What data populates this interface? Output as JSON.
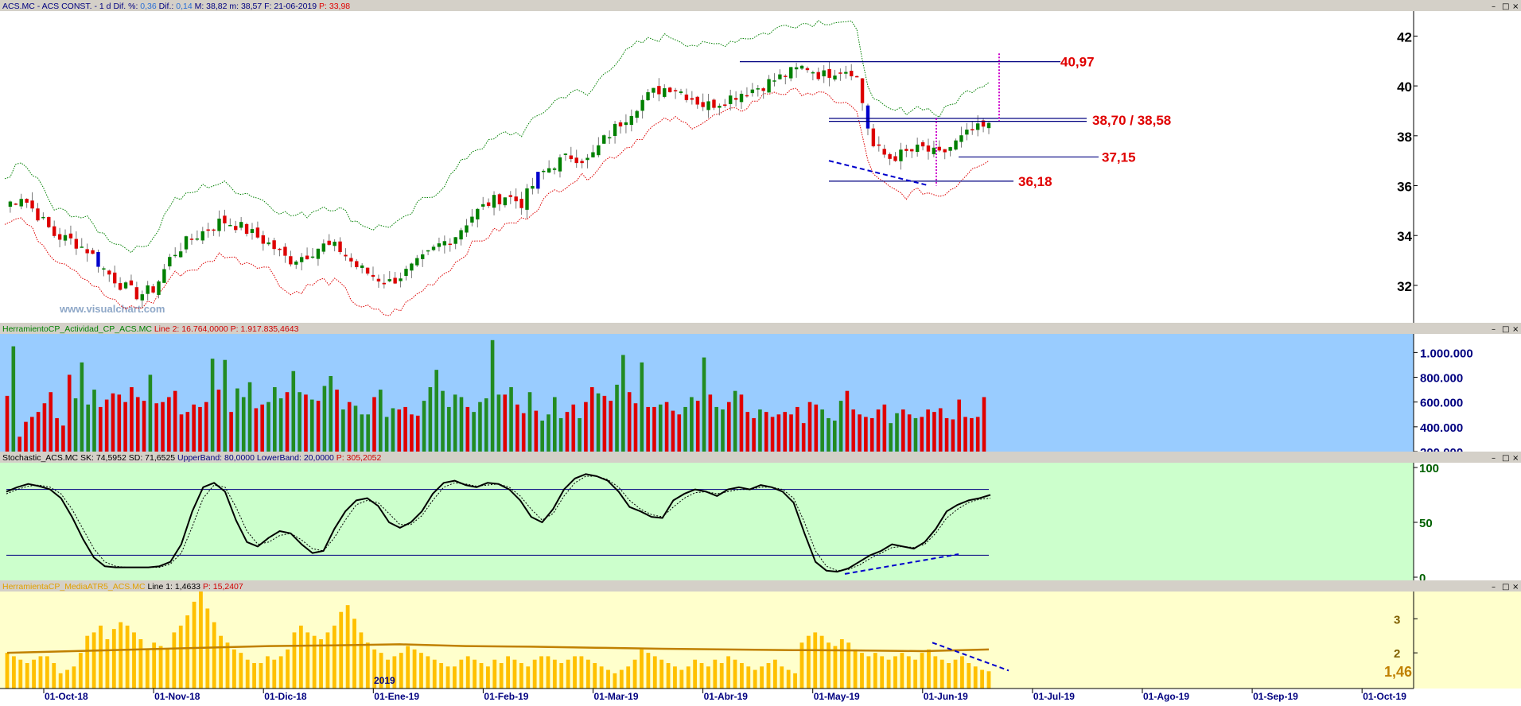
{
  "panels": {
    "price": {
      "title_parts": [
        {
          "text": "ACS.MC - ACS CONST. -  1 d  Dif. %: ",
          "color": "#000080"
        },
        {
          "text": "0,36",
          "color": "#2a6fd6"
        },
        {
          "text": "  Dif.: ",
          "color": "#000080"
        },
        {
          "text": "0,14",
          "color": "#2a6fd6"
        },
        {
          "text": "  M: 38,82  m: 38,57  F: 21-06-2019  ",
          "color": "#000080"
        },
        {
          "text": "P: 33,98",
          "color": "#e00000"
        }
      ],
      "y_ticks": [
        "32",
        "34",
        "36",
        "38",
        "40",
        "42"
      ],
      "watermark": "www.visualchart.com"
    },
    "volume": {
      "title_parts": [
        {
          "text": "HerramientoCP_Actividad_CP_ACS.MC ",
          "color": "#008000"
        },
        {
          "text": "Line 2: 16.764,0000  ",
          "color": "#d00000"
        },
        {
          "text": "P: 1.917.835,4643",
          "color": "#d00000"
        }
      ],
      "y_ticks": [
        "200.000",
        "400.000",
        "600.000",
        "800.000",
        "1.000.000"
      ]
    },
    "stochastic": {
      "title_parts": [
        {
          "text": "Stochastic_ACS.MC  SK: 74,5952  SD: 71,6525  ",
          "color": "#000000"
        },
        {
          "text": "UpperBand: 80,0000  ",
          "color": "#000080"
        },
        {
          "text": "LowerBand: 20,0000  ",
          "color": "#000080"
        },
        {
          "text": "P: 305,2052",
          "color": "#d00000"
        }
      ],
      "y_ticks": [
        "0",
        "50",
        "100"
      ]
    },
    "atr": {
      "title_parts": [
        {
          "text": "HerramientaCP_MediaATR5_ACS.MC ",
          "color": "#e0a000"
        },
        {
          "text": "Line 1: 1,4633  ",
          "color": "#000000"
        },
        {
          "text": "P: 15,2407",
          "color": "#d00000"
        }
      ],
      "y_ticks": [
        "2",
        "3"
      ],
      "last_value": "1,46",
      "year_label": "2019"
    }
  },
  "annotations": {
    "level_1": "40,97",
    "level_2": "38,70 / 38,58",
    "level_3": "37,15",
    "level_4": "36,18"
  },
  "x_axis_labels": [
    "01-Oct-18",
    "01-Nov-18",
    "01-Dic-18",
    "01-Ene-19",
    "01-Feb-19",
    "01-Mar-19",
    "01-Abr-19",
    "01-May-19",
    "01-Jun-19",
    "01-Jul-19",
    "01-Ago-19",
    "01-Sep-19",
    "01-Oct-19"
  ],
  "window_buttons": [
    "–",
    "□",
    "×"
  ],
  "colors": {
    "price_bg": "#ffffff",
    "volume_bg": "#99ccff",
    "stoch_bg": "#ccffcc",
    "atr_bg": "#ffffcc",
    "up_candle": "#008000",
    "down_candle": "#dd0000",
    "blue_candle": "#0000cc",
    "upper_band": "#008000",
    "lower_band": "#dd0000",
    "atr_bars": "#ffc000",
    "atr_avg": "#c08000",
    "level_text": "#e00000",
    "level_line": "#000080"
  },
  "chart_data": [
    {
      "type": "candlestick",
      "title": "ACS.MC - ACS CONST.",
      "period": "1 d",
      "x_start": "2018-09-21",
      "x_end": "2019-06-21",
      "ylim": [
        30.5,
        43
      ],
      "close_series": [
        35.2,
        35.6,
        34.8,
        34.0,
        33.8,
        33.4,
        32.6,
        32.0,
        31.6,
        31.9,
        33.2,
        33.8,
        34.2,
        34.6,
        34.4,
        34.0,
        33.6,
        33.0,
        33.2,
        33.6,
        33.5,
        32.8,
        32.4,
        32.1,
        32.5,
        33.0,
        33.6,
        34.0,
        34.8,
        35.3,
        35.6,
        35.3,
        36.4,
        36.9,
        37.2,
        37.0,
        37.9,
        38.6,
        39.3,
        39.8,
        40.0,
        39.6,
        39.2,
        39.4,
        39.7,
        39.9,
        40.2,
        40.5,
        40.8,
        40.4,
        40.7,
        40.6,
        37.6,
        37.1,
        37.3,
        37.5,
        37.2,
        37.7,
        38.2,
        38.35
      ],
      "upper_band": [
        36.3,
        36.9,
        36.2,
        35.0,
        34.9,
        34.6,
        34.0,
        33.6,
        33.4,
        34.0,
        35.4,
        35.6,
        36.0,
        36.1,
        35.8,
        35.6,
        35.2,
        34.8,
        34.8,
        35.2,
        35.1,
        34.6,
        34.3,
        34.4,
        34.6,
        35.4,
        35.8,
        36.6,
        37.4,
        37.7,
        38.1,
        38.1,
        38.8,
        39.4,
        39.8,
        39.6,
        40.6,
        41.2,
        41.7,
        41.9,
        42.0,
        41.7,
        41.6,
        41.7,
        41.9,
        42.0,
        42.2,
        42.5,
        42.5,
        42.6,
        42.6,
        42.4,
        39.4,
        39.0,
        39.0,
        39.2,
        38.8,
        39.4,
        39.9,
        40.2
      ],
      "lower_band": [
        34.6,
        34.7,
        33.9,
        33.1,
        32.8,
        32.2,
        31.6,
        31.1,
        31.1,
        31.4,
        32.4,
        32.6,
        32.8,
        33.3,
        33.0,
        32.9,
        32.6,
        31.6,
        31.9,
        32.2,
        32.1,
        31.3,
        31.0,
        30.8,
        31.2,
        31.8,
        32.3,
        32.9,
        33.6,
        34.0,
        34.4,
        34.6,
        35.2,
        35.8,
        36.2,
        36.4,
        37.0,
        37.4,
        37.9,
        38.4,
        38.7,
        38.4,
        38.6,
        38.9,
        39.0,
        39.4,
        39.8,
        39.7,
        39.8,
        39.6,
        39.4,
        39.1,
        36.4,
        35.9,
        35.6,
        35.8,
        35.6,
        36.0,
        36.8,
        37.0
      ],
      "levels": [
        40.97,
        38.7,
        38.58,
        37.15,
        36.18
      ]
    },
    {
      "type": "bar",
      "title": "HerramientoCP_Actividad_CP_ACS.MC",
      "ylim": [
        200000,
        1150000
      ],
      "values": [
        650,
        1050,
        320,
        440,
        480,
        520,
        590,
        680,
        470,
        410,
        820,
        630,
        920,
        580,
        700,
        560,
        620,
        670,
        660,
        600,
        720,
        640,
        610,
        820,
        590,
        600,
        640,
        690,
        500,
        520,
        580,
        560,
        600,
        950,
        700,
        940,
        520,
        710,
        640,
        760,
        550,
        580,
        600,
        720,
        630,
        680,
        850,
        680,
        660,
        620,
        610,
        730,
        810,
        700,
        540,
        600,
        570,
        500,
        500,
        640,
        700,
        480,
        550,
        540,
        560,
        500,
        490,
        610,
        720,
        860,
        690,
        560,
        660,
        640,
        560,
        520,
        600,
        630,
        1100,
        660,
        660,
        720,
        580,
        510,
        680,
        530,
        450,
        500,
        640,
        470,
        520,
        580,
        470,
        600,
        720,
        670,
        650,
        610,
        740,
        980,
        680,
        590,
        920,
        560,
        560,
        580,
        600,
        530,
        500,
        560,
        640,
        610,
        960,
        660,
        560,
        540,
        600,
        690,
        660,
        520,
        470,
        540,
        520,
        480,
        500,
        520,
        500,
        560,
        430,
        600,
        580,
        540,
        470,
        450,
        610,
        690,
        540,
        500,
        480,
        470,
        540,
        580,
        430,
        510,
        540,
        500,
        470,
        480,
        540,
        520,
        550,
        470,
        460,
        620,
        480,
        470,
        480,
        640
      ],
      "up_flags": [
        0,
        1,
        0,
        0,
        0,
        0,
        0,
        0,
        0,
        0,
        0,
        1,
        1,
        1,
        1,
        0,
        0,
        0,
        0,
        0,
        0,
        0,
        0,
        1,
        0,
        0,
        0,
        0,
        0,
        0,
        0,
        0,
        0,
        1,
        0,
        1,
        0,
        1,
        1,
        1,
        0,
        0,
        1,
        1,
        1,
        0,
        1,
        1,
        0,
        1,
        0,
        1,
        1,
        0,
        1,
        0,
        1,
        1,
        1,
        0,
        1,
        1,
        1,
        0,
        0,
        0,
        0,
        1,
        1,
        1,
        1,
        1,
        1,
        1,
        0,
        1,
        1,
        1,
        1,
        1,
        0,
        1,
        0,
        0,
        1,
        0,
        1,
        1,
        1,
        1,
        0,
        0,
        1,
        0,
        0,
        1,
        0,
        0,
        1,
        1,
        0,
        0,
        1,
        0,
        0,
        1,
        0,
        0,
        0,
        1,
        1,
        0,
        1,
        0,
        1,
        1,
        0,
        1,
        0,
        0,
        0,
        1,
        0,
        0,
        0,
        0,
        0,
        0,
        0,
        0,
        0,
        1,
        1,
        1,
        1,
        0,
        0,
        0,
        0,
        0,
        0,
        0,
        1,
        1,
        0,
        0,
        1,
        0,
        0,
        0,
        0,
        0,
        0,
        0,
        0,
        0,
        0,
        0,
        0,
        0,
        0
      ]
    },
    {
      "type": "line",
      "title": "Stochastic_ACS.MC",
      "ylim": [
        0,
        100
      ],
      "bands": [
        20,
        80
      ],
      "sk": [
        78,
        82,
        85,
        83,
        80,
        72,
        55,
        35,
        18,
        10,
        9,
        9,
        9,
        9,
        10,
        14,
        30,
        60,
        82,
        86,
        78,
        52,
        32,
        28,
        36,
        42,
        40,
        30,
        22,
        24,
        44,
        60,
        70,
        72,
        65,
        50,
        45,
        50,
        60,
        76,
        86,
        88,
        84,
        82,
        86,
        85,
        80,
        70,
        55,
        50,
        62,
        80,
        90,
        94,
        92,
        88,
        78,
        64,
        60,
        55,
        54,
        70,
        76,
        80,
        78,
        74,
        80,
        82,
        80,
        84,
        82,
        78,
        68,
        40,
        14,
        6,
        5,
        8,
        14,
        20,
        24,
        30,
        28,
        26,
        32,
        44,
        60,
        66,
        70,
        72,
        75
      ],
      "sd": [
        76,
        80,
        83,
        84,
        82,
        76,
        62,
        44,
        26,
        14,
        10,
        9,
        9,
        9,
        9,
        12,
        22,
        46,
        72,
        84,
        82,
        64,
        42,
        30,
        32,
        38,
        40,
        34,
        26,
        24,
        36,
        52,
        66,
        70,
        68,
        58,
        48,
        48,
        56,
        70,
        82,
        86,
        85,
        83,
        84,
        85,
        82,
        74,
        62,
        52,
        58,
        74,
        86,
        92,
        92,
        89,
        82,
        70,
        62,
        57,
        55,
        64,
        72,
        77,
        78,
        76,
        78,
        80,
        80,
        82,
        82,
        80,
        72,
        50,
        24,
        10,
        6,
        7,
        11,
        17,
        22,
        27,
        28,
        27,
        30,
        40,
        54,
        62,
        68,
        71,
        72
      ]
    },
    {
      "type": "bar",
      "title": "HerramientaCP_MediaATR5_ACS.MC",
      "ylim": [
        1,
        3.8
      ],
      "values": [
        2.0,
        1.9,
        1.8,
        1.7,
        1.8,
        1.9,
        1.9,
        1.7,
        1.4,
        1.5,
        1.6,
        2.0,
        2.5,
        2.6,
        2.8,
        2.4,
        2.7,
        2.9,
        2.8,
        2.6,
        2.4,
        2.1,
        2.3,
        2.2,
        2.1,
        2.6,
        2.8,
        3.1,
        3.5,
        3.8,
        3.3,
        2.9,
        2.5,
        2.3,
        2.1,
        2.0,
        1.8,
        1.7,
        1.7,
        1.9,
        1.8,
        1.9,
        2.1,
        2.6,
        2.8,
        2.6,
        2.5,
        2.4,
        2.6,
        2.8,
        3.2,
        3.4,
        3.0,
        2.6,
        2.3,
        2.1,
        2.0,
        1.8,
        1.9,
        2.0,
        2.2,
        2.1,
        2.0,
        1.9,
        1.8,
        1.7,
        1.6,
        1.6,
        1.8,
        1.9,
        1.8,
        1.7,
        1.6,
        1.8,
        1.7,
        1.9,
        1.8,
        1.7,
        1.6,
        1.8,
        1.9,
        1.9,
        1.8,
        1.7,
        1.8,
        1.9,
        1.9,
        1.8,
        1.7,
        1.6,
        1.5,
        1.4,
        1.5,
        1.6,
        1.8,
        2.1,
        2.0,
        1.9,
        1.8,
        1.7,
        1.6,
        1.5,
        1.6,
        1.8,
        1.7,
        1.6,
        1.8,
        1.7,
        1.9,
        1.8,
        1.7,
        1.6,
        1.5,
        1.6,
        1.7,
        1.8,
        1.6,
        1.5,
        1.4,
        2.3,
        2.5,
        2.6,
        2.5,
        2.3,
        2.2,
        2.4,
        2.3,
        2.1,
        2.0,
        1.9,
        2.0,
        1.9,
        1.8,
        1.9,
        2.0,
        1.9,
        1.8,
        2.0,
        2.1,
        1.9,
        1.8,
        1.7,
        1.8,
        1.9,
        1.7,
        1.6,
        1.5,
        1.46
      ],
      "avg_line": [
        2.0,
        2.05,
        2.1,
        2.15,
        2.2,
        2.22,
        2.25,
        2.2,
        2.18,
        2.15,
        2.12,
        2.1,
        2.08,
        2.07,
        2.05,
        2.1
      ]
    }
  ]
}
